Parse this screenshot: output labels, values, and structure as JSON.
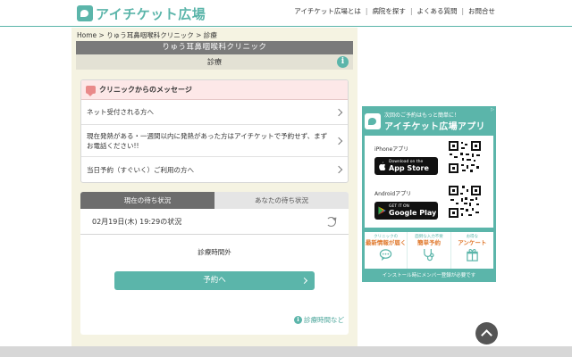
{
  "header": {
    "logo_text": "アイチケット広場",
    "nav": [
      "アイチケット広場とは",
      "病院を探す",
      "よくある質問",
      "お問合せ"
    ]
  },
  "breadcrumb": "Home > りゅう耳鼻咽喉科クリニック > 診療",
  "clinic_name": "りゅう耳鼻咽喉科クリニック",
  "section_title": "診療",
  "messages": {
    "title": "クリニックからのメッセージ",
    "items": [
      "ネット受付される方へ",
      "現在発熱がある・一週間以内に発熱があった方はアイチケットで予約せず、まずお電話ください!!",
      "当日予約（すぐいく）ご利用の方へ"
    ]
  },
  "status": {
    "tabs": [
      "現在の待ち状況",
      "あなたの待ち状況"
    ],
    "datetime": "02月19日(木) 19:29の状況",
    "closed_text": "診療時間外",
    "reserve_label": "予約へ"
  },
  "hours_link": "診療時間など",
  "ad": {
    "headline_small": "次回のご予約はもっと簡単に！",
    "headline_big": "アイチケット広場アプリ",
    "iphone_label": "iPhoneアプリ",
    "appstore_small": "Download on the",
    "appstore_big": "App Store",
    "android_label": "Androidアプリ",
    "gplay_small": "GET IT ON",
    "gplay_big": "Google Play",
    "features": [
      {
        "small": "クリニックの",
        "big": "最新情報が届く",
        "icon": "chat-icon"
      },
      {
        "small": "面倒な入力不要",
        "big": "簡単予約",
        "icon": "stethoscope-icon"
      },
      {
        "small": "お得な",
        "big": "アンケート",
        "icon": "gift-icon"
      }
    ],
    "footer": "インストール時にメンバー登録が必要です",
    "accent_color": "#5bb5aa"
  }
}
